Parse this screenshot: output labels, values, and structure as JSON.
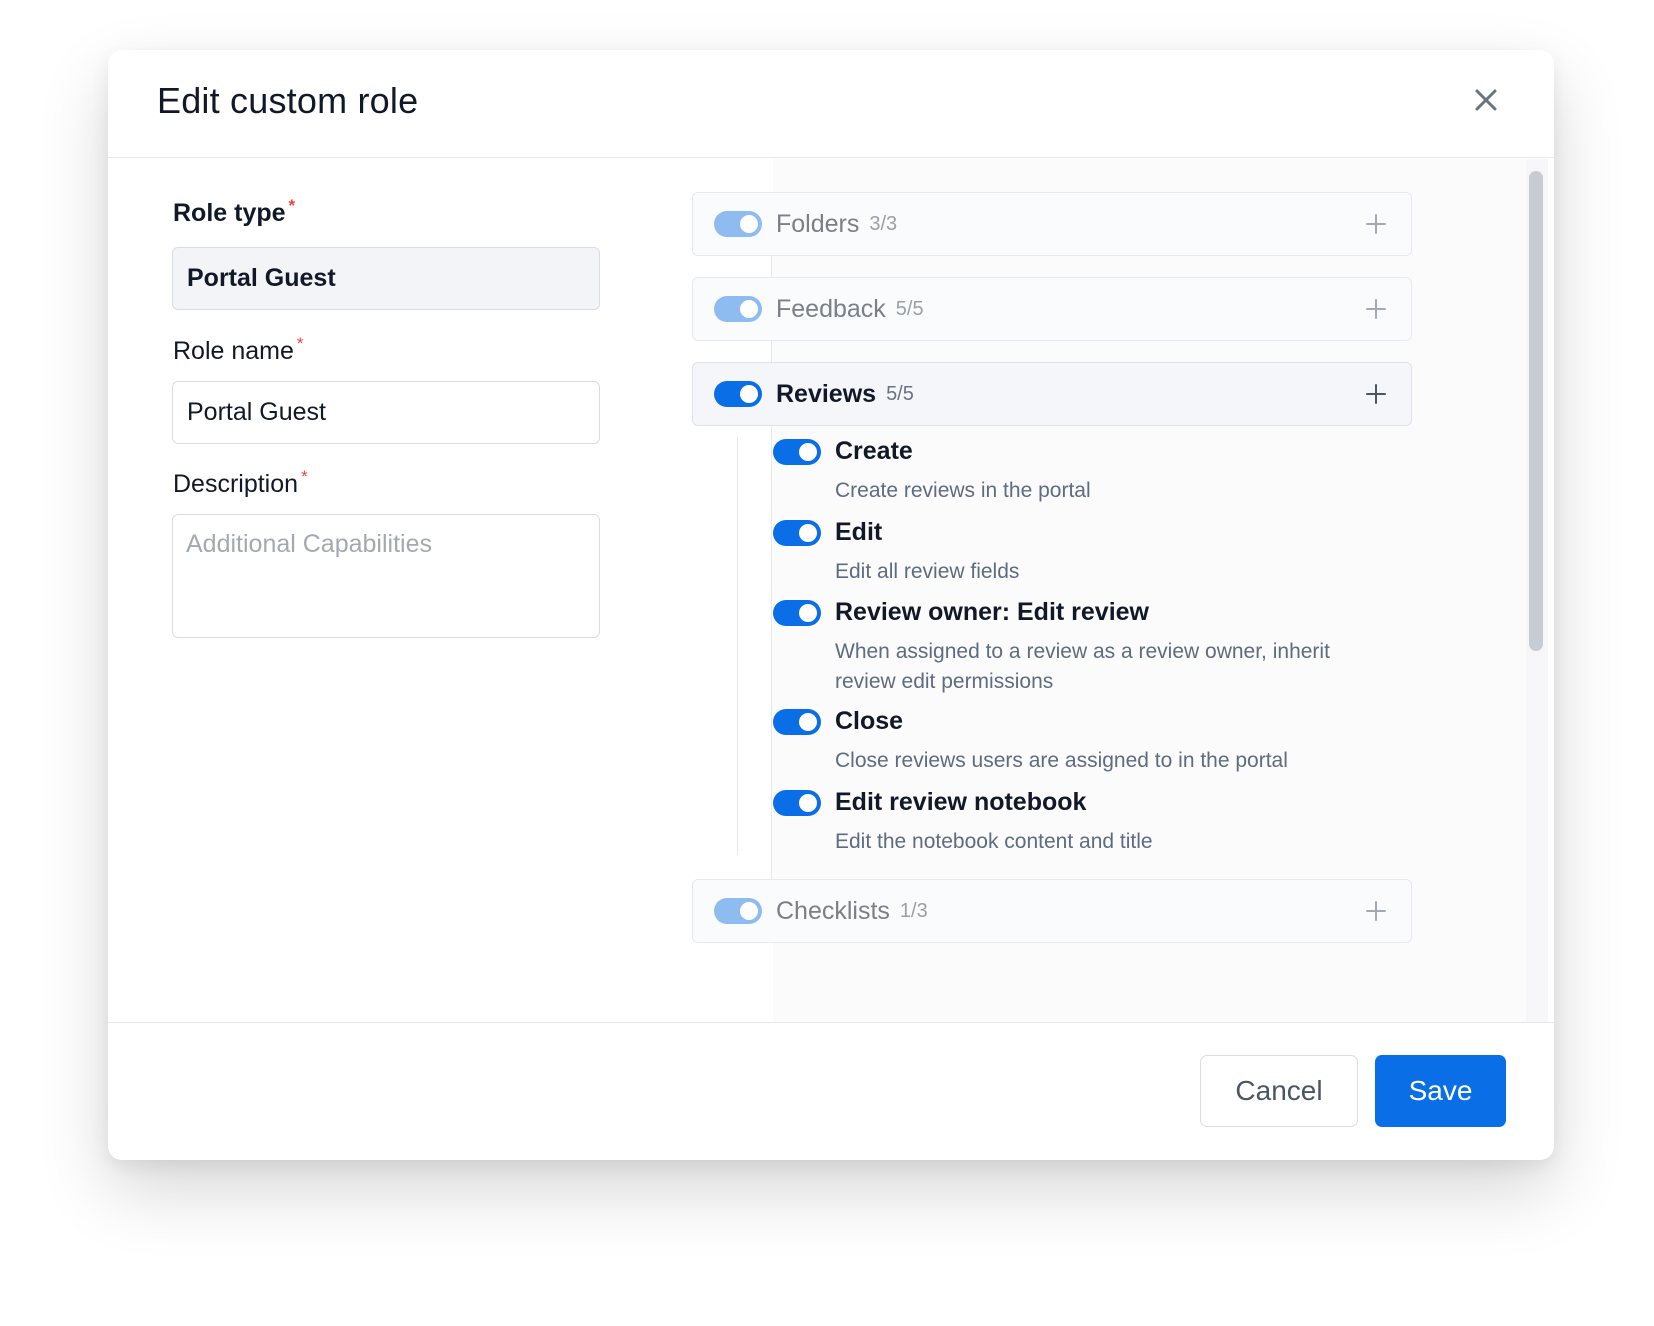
{
  "modal": {
    "title": "Edit custom role"
  },
  "form": {
    "role_type": {
      "label": "Role type",
      "required_mark": "*",
      "value": "Portal Guest"
    },
    "role_name": {
      "label": "Role name",
      "required_mark": "*",
      "value": "Portal Guest"
    },
    "description": {
      "label": "Description",
      "required_mark": "*",
      "value": "",
      "placeholder": "Additional Capabilities"
    }
  },
  "permission_groups": [
    {
      "name": "Folders",
      "count": "3/3",
      "enabled": true,
      "expanded": false
    },
    {
      "name": "Feedback",
      "count": "5/5",
      "enabled": true,
      "expanded": false
    },
    {
      "name": "Reviews",
      "count": "5/5",
      "enabled": true,
      "expanded": true
    },
    {
      "name": "Checklists",
      "count": "1/3",
      "enabled": true,
      "expanded": false
    }
  ],
  "review_permissions": [
    {
      "name": "Create",
      "description": "Create reviews in the portal",
      "enabled": true
    },
    {
      "name": "Edit",
      "description": "Edit all review fields",
      "enabled": true
    },
    {
      "name": "Review owner: Edit review",
      "description": "When assigned to a review as a review owner, inherit review edit permissions",
      "enabled": true
    },
    {
      "name": "Close",
      "description": "Close reviews users are assigned to in the portal",
      "enabled": true
    },
    {
      "name": "Edit review notebook",
      "description": "Edit the notebook content and title",
      "enabled": true
    }
  ],
  "footer": {
    "cancel_label": "Cancel",
    "save_label": "Save"
  },
  "colors": {
    "accent": "#0a6ee6",
    "accent_faded": "#8ebcf1",
    "required": "#ef4444"
  },
  "icons": {
    "close": "close-icon",
    "expand": "plus-icon"
  }
}
